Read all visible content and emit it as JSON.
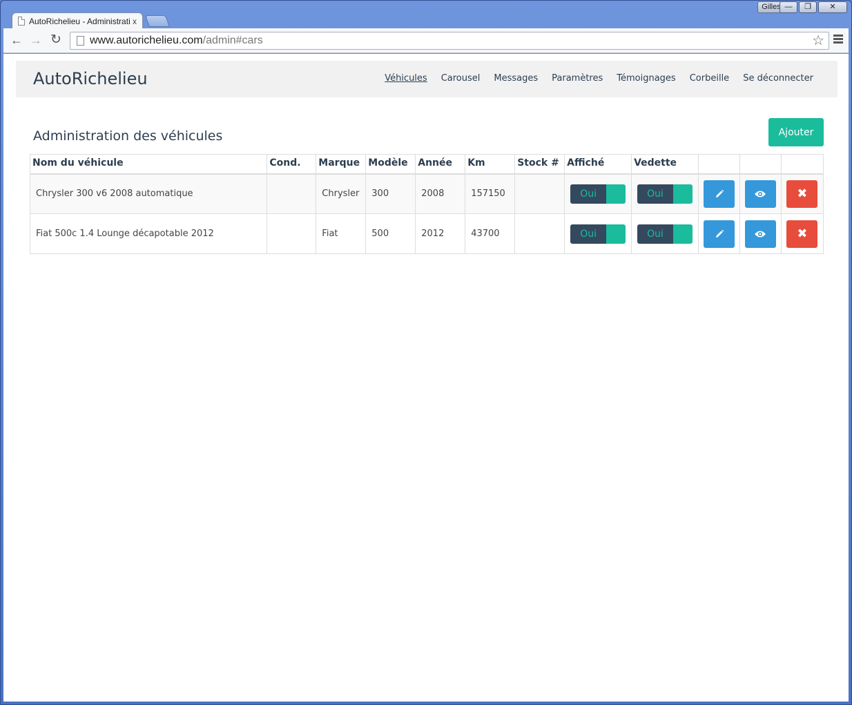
{
  "window": {
    "user_label": "Gilles",
    "minimize_glyph": "—",
    "maximize_glyph": "❐",
    "close_glyph": "✕"
  },
  "tab": {
    "title": "AutoRichelieu - Administratio",
    "close_glyph": "x"
  },
  "toolbar": {
    "back_glyph": "←",
    "forward_glyph": "→",
    "reload_glyph": "↻",
    "url_host": "www.autorichelieu.com",
    "url_path": "/admin#cars",
    "star_glyph": "☆"
  },
  "navbar": {
    "brand": "AutoRichelieu",
    "links": [
      {
        "label": "Véhicules",
        "active": true
      },
      {
        "label": "Carousel"
      },
      {
        "label": "Messages"
      },
      {
        "label": "Paramètres"
      },
      {
        "label": "Témoignages"
      },
      {
        "label": "Corbeille"
      },
      {
        "label": "Se déconnecter"
      }
    ]
  },
  "page": {
    "heading": "Administration des véhicules",
    "add_button": "Ajouter"
  },
  "table": {
    "headers": [
      "Nom du véhicule",
      "Cond.",
      "Marque",
      "Modèle",
      "Année",
      "Km",
      "Stock #",
      "Affiché",
      "Vedette",
      "",
      "",
      ""
    ],
    "rows": [
      {
        "name": "Chrysler 300 v6 2008 automatique",
        "cond": "",
        "make": "Chrysler",
        "model": "300",
        "year": "2008",
        "km": "157150",
        "stock": "",
        "shown": "Oui",
        "featured": "Oui",
        "delete_glyph": "✖"
      },
      {
        "name": "Fiat 500c 1.4 Lounge décapotable 2012",
        "cond": "",
        "make": "Fiat",
        "model": "500",
        "year": "2012",
        "km": "43700",
        "stock": "",
        "shown": "Oui",
        "featured": "Oui",
        "delete_glyph": "✖"
      }
    ]
  },
  "colors": {
    "primary": "#2c3e50",
    "accent_green": "#1abc9c",
    "action_blue": "#3498db",
    "danger_red": "#e74c3c",
    "toggle_dark": "#34495e"
  },
  "icons": [
    "pencil-icon",
    "eye-icon",
    "close-icon"
  ]
}
